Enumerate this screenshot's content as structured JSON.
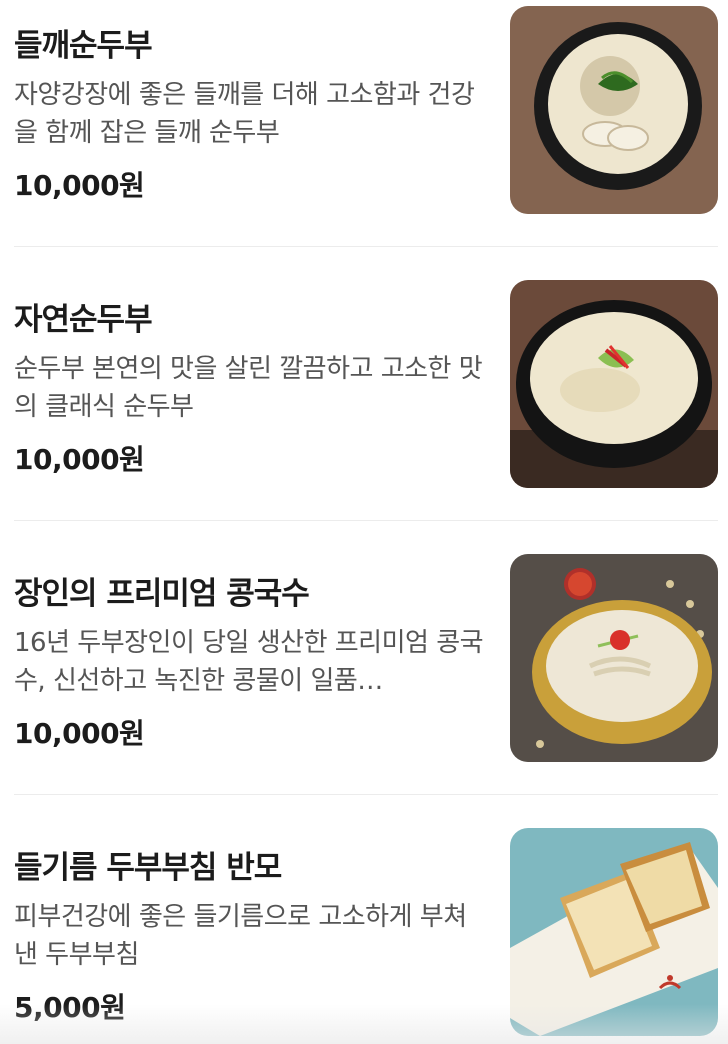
{
  "menu": {
    "items": [
      {
        "name": "들깨순두부",
        "description": "자양강장에 좋은 들깨를 더해 고소함과 건강을 함께 잡은 들깨 순두부",
        "price": "10,000원",
        "image_icon": "perilla-soft-tofu-photo"
      },
      {
        "name": "자연순두부",
        "description": "순두부 본연의 맛을 살린 깔끔하고 고소한 맛의 클래식 순두부",
        "price": "10,000원",
        "image_icon": "natural-soft-tofu-photo"
      },
      {
        "name": "장인의 프리미엄 콩국수",
        "description": "16년 두부장인이 당일 생산한 프리미엄 콩국수, 신선하고 녹진한 콩물이 일품…",
        "price": "10,000원",
        "image_icon": "soy-noodle-soup-photo"
      },
      {
        "name": "들기름 두부부침 반모",
        "description": "피부건강에 좋은 들기름으로 고소하게 부쳐 낸 두부부침",
        "price": "5,000원",
        "image_icon": "pan-fried-tofu-photo"
      }
    ]
  }
}
